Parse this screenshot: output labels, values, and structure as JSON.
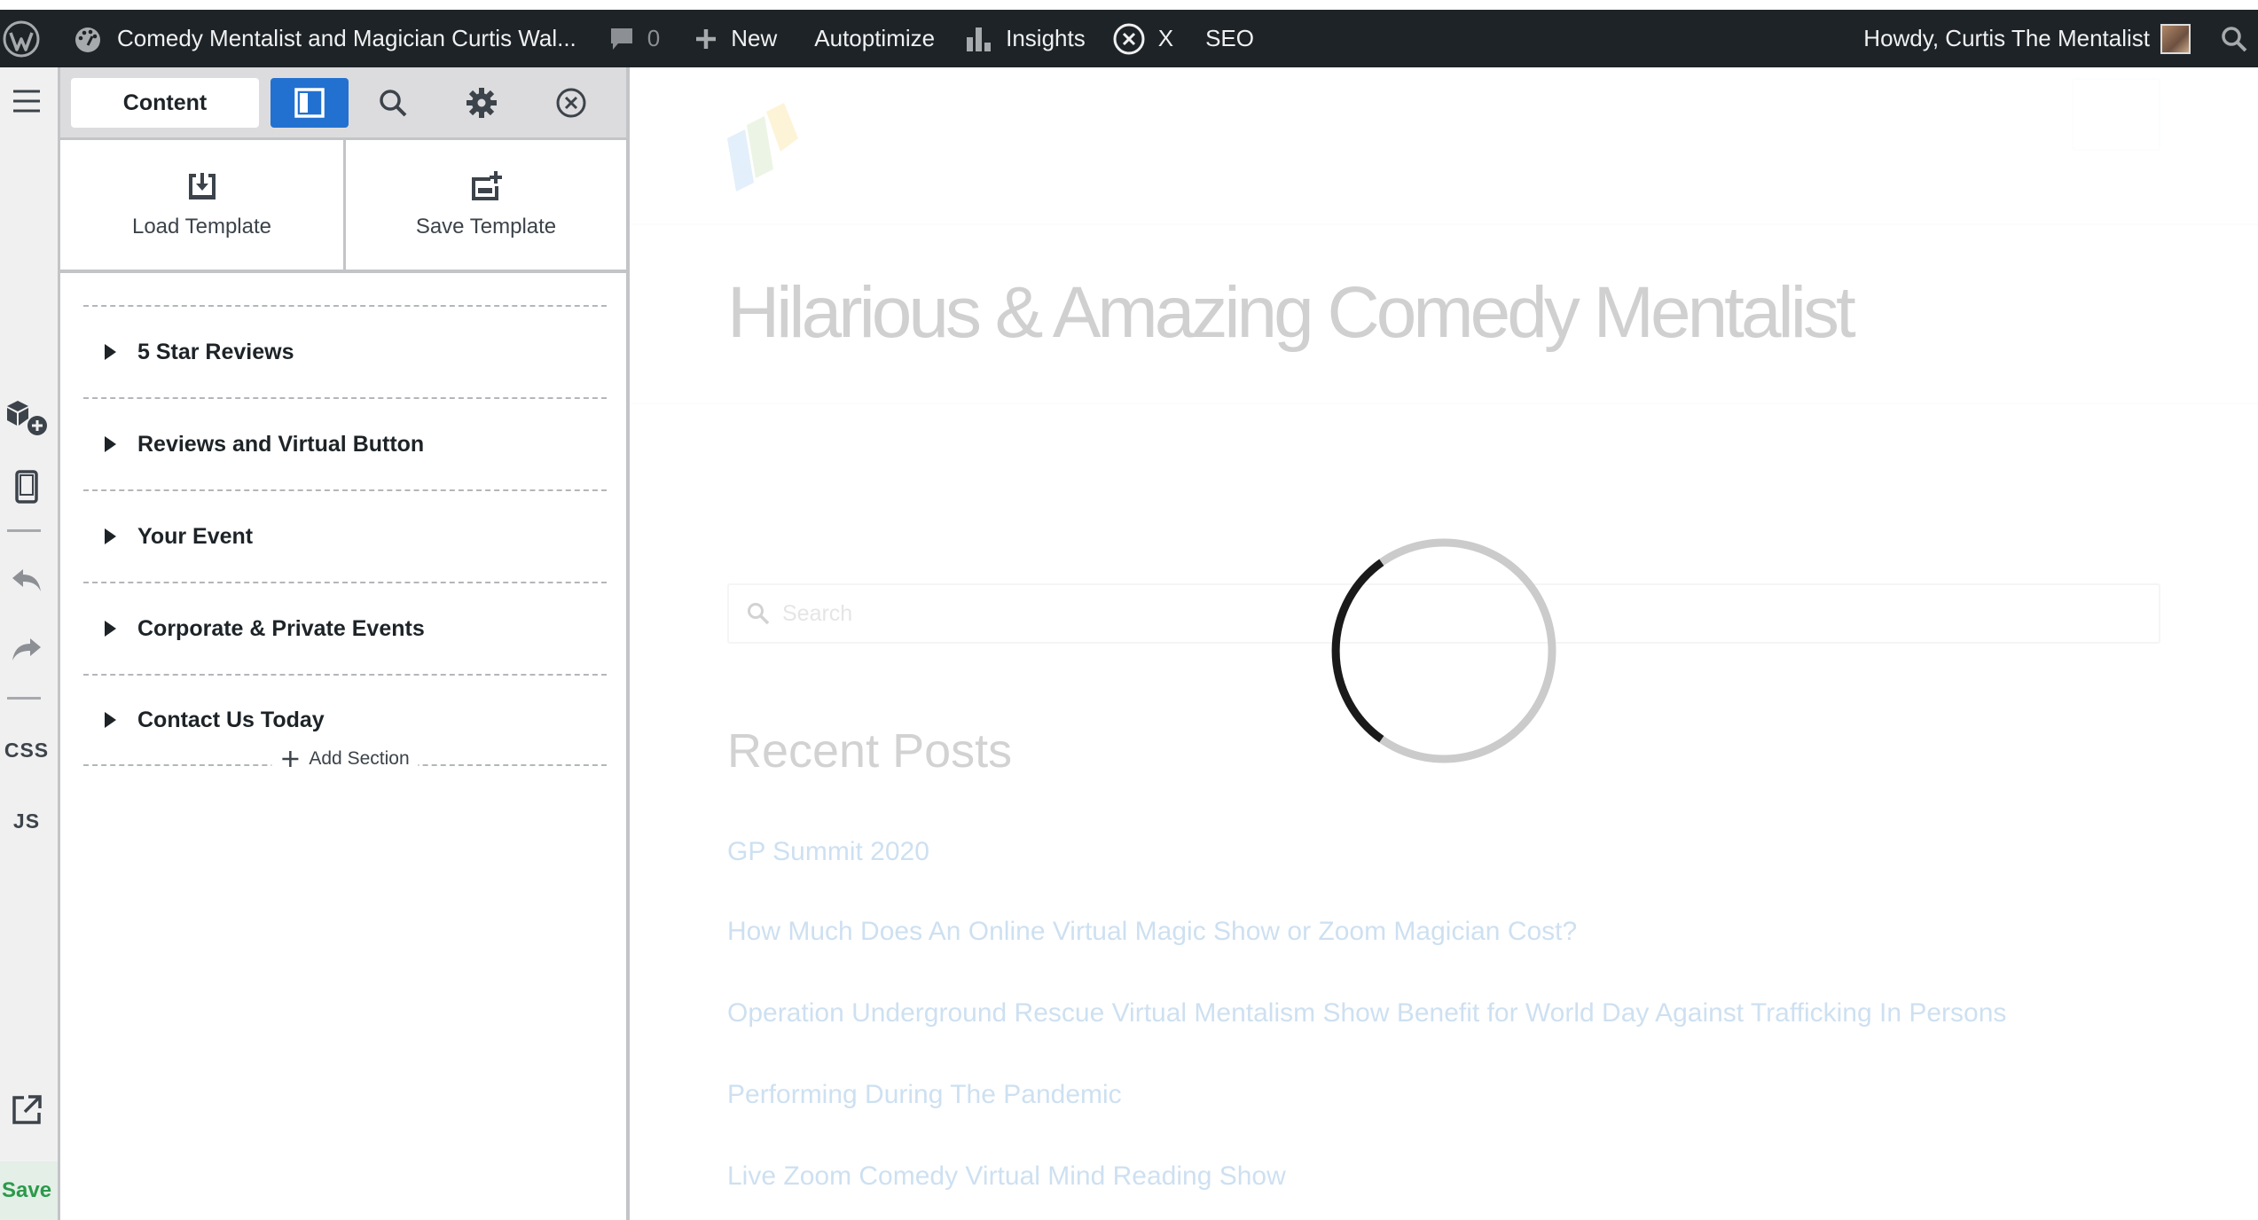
{
  "adminbar": {
    "site_name": "Comedy Mentalist and Magician Curtis Wal...",
    "comments_count": "0",
    "new_label": "New",
    "autoptimize_label": "Autoptimize",
    "insights_label": "Insights",
    "x_label": "X",
    "seo_label": "SEO",
    "howdy_label": "Howdy, Curtis The Mentalist"
  },
  "vtool": {
    "css_label": "CSS",
    "js_label": "JS",
    "save_label": "Save"
  },
  "panel": {
    "content_tab": "Content",
    "load_template": "Load Template",
    "save_template": "Save Template",
    "sections": [
      {
        "label": "5 Star Reviews"
      },
      {
        "label": "Reviews and Virtual Button"
      },
      {
        "label": "Your Event"
      },
      {
        "label": "Corporate & Private Events"
      },
      {
        "label": "Contact Us Today"
      }
    ],
    "add_section": "Add Section"
  },
  "preview": {
    "page_title": "Hilarious & Amazing Comedy Mentalist",
    "search_placeholder": "Search",
    "recent_posts_heading": "Recent Posts",
    "posts": [
      "GP Summit 2020",
      "How Much Does An Online Virtual Magic Show or Zoom Magician Cost?",
      "Operation Underground Rescue Virtual Mentalism Show Benefit for World Day Against Trafficking In Persons",
      "Performing During The Pandemic",
      "Live Zoom Comedy Virtual Mind Reading Show"
    ]
  },
  "colors": {
    "adminbar_bg": "#1d2327",
    "accent_blue": "#2271d1",
    "save_green": "#2b9a4a"
  }
}
